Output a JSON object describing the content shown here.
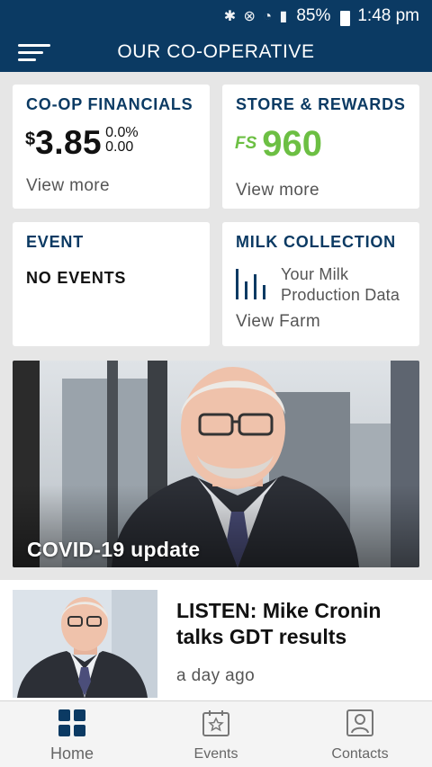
{
  "status_bar": {
    "icons": [
      "bluetooth-icon",
      "mute-icon",
      "wifi-icon",
      "signal-icon",
      "battery-icon"
    ],
    "battery": "85%",
    "time": "1:48 pm"
  },
  "app_bar": {
    "title": "OUR CO-OPERATIVE",
    "menu_icon": "hamburger-menu-icon"
  },
  "cards": {
    "financials": {
      "title": "CO-OP FINANCIALS",
      "currency": "$",
      "value": "3.85",
      "change_pct": "0.0%",
      "change_abs": "0.00",
      "link": "View more"
    },
    "rewards": {
      "title": "STORE & REWARDS",
      "points_icon": "FS",
      "points": "960",
      "link": "View more"
    },
    "event": {
      "title": "EVENT",
      "empty_text": "NO EVENTS"
    },
    "milk": {
      "title": "MILK COLLECTION",
      "icon": "bar-chart-icon",
      "line1": "Your Milk",
      "line2": "Production Data",
      "link": "View Farm"
    }
  },
  "hero": {
    "caption": "COVID-19 update"
  },
  "article": {
    "headline": "LISTEN: Mike Cronin talks GDT results",
    "time": "a day ago"
  },
  "nav": {
    "items": [
      {
        "label": "Home",
        "icon": "home-grid-icon",
        "active": true
      },
      {
        "label": "Events",
        "icon": "calendar-star-icon",
        "active": false
      },
      {
        "label": "Contacts",
        "icon": "contact-card-icon",
        "active": false
      }
    ]
  },
  "colors": {
    "brand_navy": "#0b3a63",
    "rewards_green": "#6cbf43",
    "background": "#e6e6e6"
  }
}
